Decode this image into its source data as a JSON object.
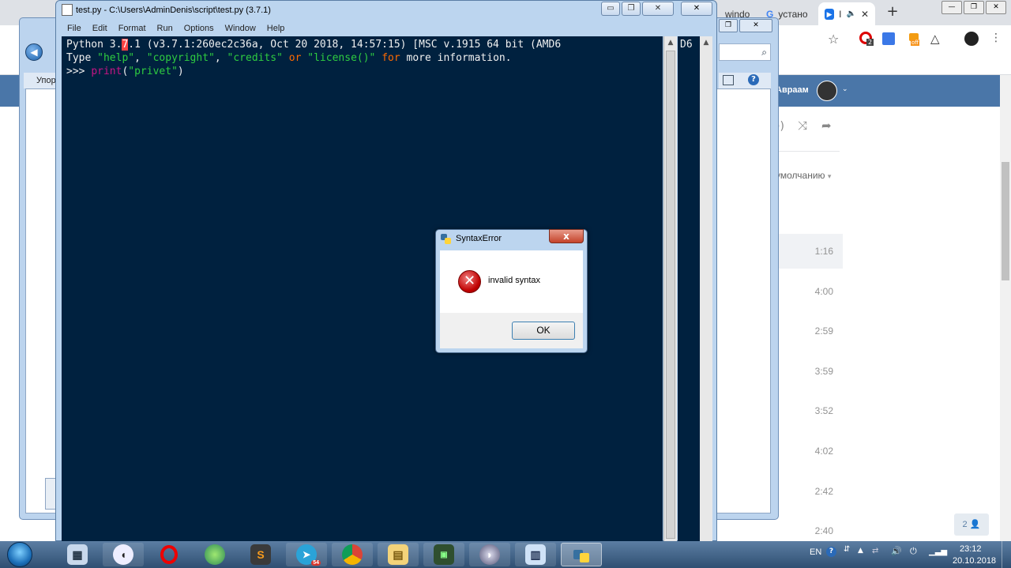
{
  "browser": {
    "tabs": [
      {
        "label": "windo",
        "active": false
      },
      {
        "label": "устано",
        "active": false
      },
      {
        "label": "I",
        "active": true
      }
    ],
    "new_tab": "+",
    "vk_user": "Авраам",
    "sort_label": "умолчанию",
    "track_times": [
      "1:16",
      "4:00",
      "2:59",
      "3:59",
      "3:52",
      "4:02",
      "2:42",
      "2:40"
    ],
    "friends_badge": "2",
    "ext_badge_1": "2",
    "ext_badge_2": "off"
  },
  "explorer": {
    "organize_label": "Упор"
  },
  "idle": {
    "title": "test.py - C:\\Users\\AdminDenis\\script\\test.py (3.7.1)",
    "menu": [
      "File",
      "Edit",
      "Format",
      "Run",
      "Options",
      "Window",
      "Help"
    ],
    "shell": {
      "line1_a": "Python 3.",
      "line1_cursor": "7",
      "line1_b": ".1 (v3.7.1:260ec2c36a, Oct 20 2018, 14:57:15) [MSC v.1915 64 bit (AMD6",
      "line2_type": "Type ",
      "line2_help": "\"help\"",
      "line2_sep1": ", ",
      "line2_copyright": "\"copyright\"",
      "line2_sep2": ", ",
      "line2_credits": "\"credits\"",
      "line2_or": " or ",
      "line2_license": "\"license()\"",
      "line2_for": " for",
      "line2_more": " more information.",
      "line3_prompt": ">>> ",
      "line3_print": "print",
      "line3_paren_open": "(",
      "line3_string": "\"privet\"",
      "line3_paren_close": ")"
    },
    "shell2_text": "D6"
  },
  "dialog": {
    "title": "SyntaxError",
    "message": "invalid syntax",
    "ok_label": "OK",
    "close_glyph": "x"
  },
  "taskbar": {
    "telegram_badge": "54",
    "language": "EN",
    "time": "23:12",
    "date": "20.10.2018"
  },
  "colors": {
    "shell_bg": "#00213f",
    "string": "#2ecc40",
    "keyword": "#ff6a00",
    "builtin": "#c71585",
    "vk_blue": "#4a76a8"
  }
}
